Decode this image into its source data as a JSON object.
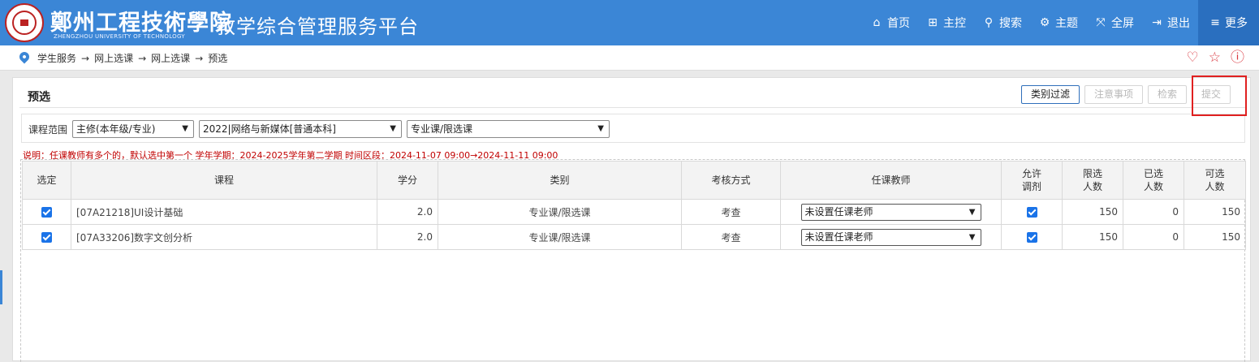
{
  "header": {
    "logo_text": "鄭州工程技術學院",
    "logo_en": "ZHENGZHOU UNIVERSITY OF TECHNOLOGY",
    "app_title": "教学综合管理服务平台",
    "nav": [
      {
        "label": "首页",
        "icon": "home-icon"
      },
      {
        "label": "主控",
        "icon": "windows-icon"
      },
      {
        "label": "搜索",
        "icon": "search-icon"
      },
      {
        "label": "主题",
        "icon": "gears-icon"
      },
      {
        "label": "全屏",
        "icon": "fullscreen-icon"
      },
      {
        "label": "退出",
        "icon": "sign-out-icon"
      },
      {
        "label": "更多",
        "icon": "menu-icon"
      }
    ]
  },
  "breadcrumb": {
    "items": [
      "学生服务",
      "网上选课",
      "网上选课",
      "预选"
    ],
    "separator": "→"
  },
  "panel": {
    "title": "预选",
    "buttons": {
      "filter": "类别过滤",
      "notice": "注意事项",
      "check": "检索",
      "submit": "提交"
    }
  },
  "filter": {
    "label": "课程范围",
    "scope_select": "主修(本年级/专业)",
    "major_select": "2022|网络与新媒体[普通本科]",
    "category_select": "专业课/限选课"
  },
  "note": "说明：任课教师有多个的，默认选中第一个    学年学期：2024-2025学年第二学期  时间区段：2024-11-07 09:00→2024-11-11 09:00",
  "table": {
    "headers": {
      "select": "选定",
      "course": "课程",
      "credit": "学分",
      "category": "类别",
      "exam": "考核方式",
      "teacher": "任课教师",
      "adjust_1": "允许",
      "adjust_2": "调剂",
      "limit_1": "限选",
      "limit_2": "人数",
      "selected_1": "已选",
      "selected_2": "人数",
      "available_1": "可选",
      "available_2": "人数"
    },
    "rows": [
      {
        "course": "[07A21218]UI设计基础",
        "credit": "2.0",
        "category": "专业课/限选课",
        "exam": "考查",
        "teacher": "未设置任课老师",
        "limit": "150",
        "selected": "0",
        "available": "150"
      },
      {
        "course": "[07A33206]数字文创分析",
        "credit": "2.0",
        "category": "专业课/限选课",
        "exam": "考查",
        "teacher": "未设置任课老师",
        "limit": "150",
        "selected": "0",
        "available": "150"
      }
    ]
  },
  "colors": {
    "header_bg": "#3b86d6",
    "accent": "#1a73e8",
    "note_red": "#c00000",
    "highlight": "#e02020"
  }
}
